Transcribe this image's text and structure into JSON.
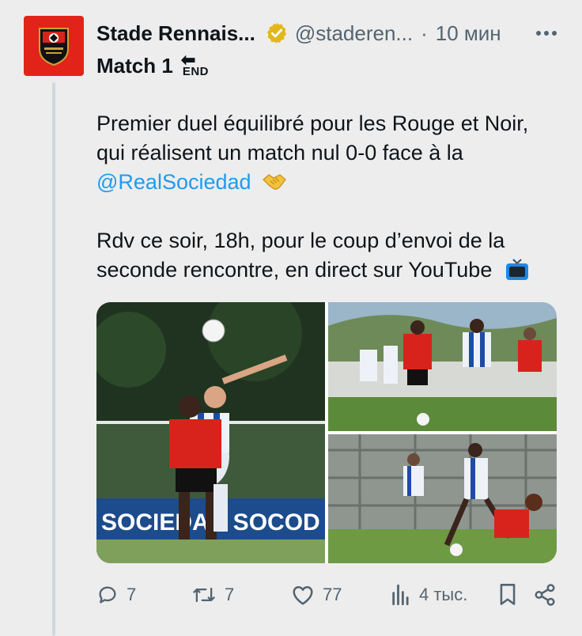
{
  "tweet": {
    "author_name": "Stade Rennais...",
    "author_handle": "@staderen...",
    "separator": "·",
    "time": "10 мин",
    "title": "Match 1",
    "end_emoji_text": "END",
    "text_line1": "Premier duel équilibré pour les Rouge et Noir,",
    "text_line2": "qui réalisent un match nul 0-0 face à la",
    "mention": "@RealSociedad",
    "text_line3": "Rdv ce soir, 18h, pour le coup d’envoi de la",
    "text_line4": "seconde rencontre, en direct sur YouTube"
  },
  "media": {
    "banner_text": "SOCIEDAD SOCOD"
  },
  "actions": {
    "replies": "7",
    "retweets": "7",
    "likes": "77",
    "views": "4 тыс."
  },
  "colors": {
    "background": "#ededed",
    "accent": "#1d9bf0",
    "muted": "#536471",
    "club_red": "#e2231a",
    "verified_gold": "#e2b719"
  },
  "icons": [
    "reply-icon",
    "retweet-icon",
    "like-icon",
    "views-icon",
    "bookmark-icon",
    "share-icon",
    "verified-icon",
    "more-icon",
    "tv-icon",
    "handshake-icon"
  ]
}
